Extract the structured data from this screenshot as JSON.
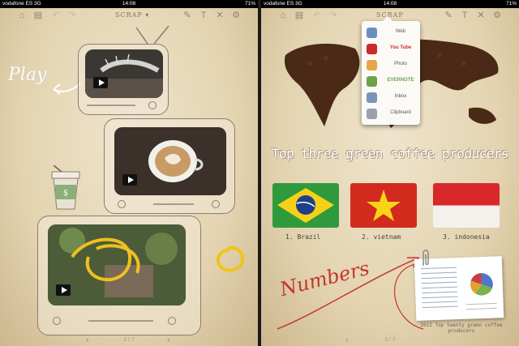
{
  "status": {
    "carrier": "vodafone ES  3G",
    "time": "14:08",
    "battery": "71%"
  },
  "toolbar": {
    "scrap_label": "SCRAP"
  },
  "left": {
    "play_text": "Play",
    "pager": "2 / 7"
  },
  "right": {
    "headline": "Top three green coffee producers",
    "flags": [
      {
        "label": "1. Brazil"
      },
      {
        "label": "2. vietnam"
      },
      {
        "label": "3. indonesia"
      }
    ],
    "numbers_text": "Numbers",
    "caption": "2012 Top twenty green coffee producers",
    "pager": "3 / 7",
    "scrap_menu": [
      {
        "label": "Web",
        "icon": "globe-icon",
        "color": "#6c8fc2"
      },
      {
        "label": "You Tube",
        "icon": "youtube-icon",
        "color": "#cc2a2a"
      },
      {
        "label": "Photo",
        "icon": "photo-icon",
        "color": "#e6a64a"
      },
      {
        "label": "EVERNOTE",
        "icon": "evernote-icon",
        "color": "#6aa34a"
      },
      {
        "label": "Inbox",
        "icon": "inbox-icon",
        "color": "#7a94b8"
      },
      {
        "label": "Clipboard",
        "icon": "clipboard-icon",
        "color": "#9aa0aa"
      }
    ]
  },
  "colors": {
    "accent_blue": "#4f79c5",
    "ink_red": "#c4362c",
    "paper": "#e8dabb"
  }
}
